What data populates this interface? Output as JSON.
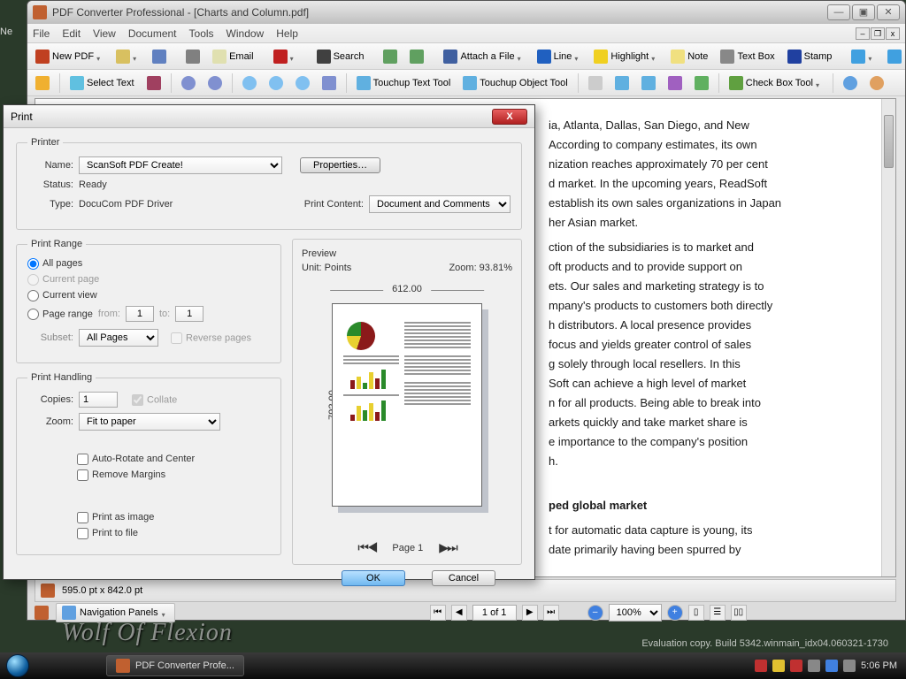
{
  "app": {
    "title": "PDF Converter Professional - [Charts and Column.pdf]",
    "task_label": "PDF Converter Profe..."
  },
  "menu": [
    "File",
    "Edit",
    "View",
    "Document",
    "Tools",
    "Window",
    "Help"
  ],
  "toolbar1": {
    "new_pdf": "New PDF",
    "email": "Email",
    "search": "Search",
    "attach": "Attach a File",
    "line": "Line",
    "highlight": "Highlight",
    "note": "Note",
    "textbox": "Text Box",
    "stamp": "Stamp"
  },
  "toolbar2": {
    "select_text": "Select Text",
    "touchup_text": "Touchup Text Tool",
    "touchup_obj": "Touchup Object Tool",
    "checkbox": "Check Box Tool"
  },
  "document": {
    "lines": [
      "ia, Atlanta, Dallas, San Diego, and New",
      "According to company estimates, its own",
      "nization reaches approximately 70 per cent",
      "d market. In the upcoming years, ReadSoft",
      "establish its own sales organizations in Japan",
      "her Asian market.",
      "ction of the subsidiaries is to market and",
      "oft products and to provide support on",
      "ets. Our sales and marketing strategy is to",
      "mpany's products to customers both directly",
      "h distributors. A local presence provides",
      "focus and yields greater control of sales",
      "g solely through local resellers. In this",
      "Soft can achieve a high level of market",
      "n for all products. Being able to break into",
      "arkets quickly and take market share is",
      "e importance to the company's position",
      "h."
    ],
    "heading": "ped global market",
    "after": [
      "t for automatic data capture is young, its",
      "date primarily having been spurred by"
    ]
  },
  "docstatus": {
    "dim": "595.0 pt x 842.0 pt"
  },
  "pager": {
    "label": "1 of 1",
    "zoom": "100%"
  },
  "navpanel": "Navigation Panels",
  "print": {
    "title": "Print",
    "printer_group": "Printer",
    "name_lbl": "Name:",
    "name_val": "ScanSoft PDF Create!",
    "properties": "Properties…",
    "status_lbl": "Status:",
    "status_val": "Ready",
    "type_lbl": "Type:",
    "type_val": "DocuCom PDF Driver",
    "pc_lbl": "Print Content:",
    "pc_val": "Document and Comments",
    "range_group": "Print Range",
    "r_all": "All pages",
    "r_cur_page": "Current page",
    "r_cur_view": "Current view",
    "r_range": "Page range",
    "from": "from:",
    "from_v": "1",
    "to": "to:",
    "to_v": "1",
    "subset_lbl": "Subset:",
    "subset_val": "All Pages",
    "reverse": "Reverse pages",
    "handling_group": "Print Handling",
    "copies_lbl": "Copies:",
    "copies_val": "1",
    "collate": "Collate",
    "zoom_lbl": "Zoom:",
    "zoom_val": "Fit to paper",
    "autorotate": "Auto-Rotate and Center",
    "remove_margins": "Remove Margins",
    "print_image": "Print as image",
    "print_file": "Print to file",
    "preview_group": "Preview",
    "unit": "Unit: Points",
    "zoom_pct": "Zoom: 93.81%",
    "dim_w": "612.00",
    "dim_h": "792.00",
    "page": "Page 1",
    "ok": "OK",
    "cancel": "Cancel"
  },
  "clock": "5:06 PM",
  "watermark": "Wolf Of Flexion",
  "eval": "Evaluation copy. Build 5342.winmain_idx04.060321-1730"
}
